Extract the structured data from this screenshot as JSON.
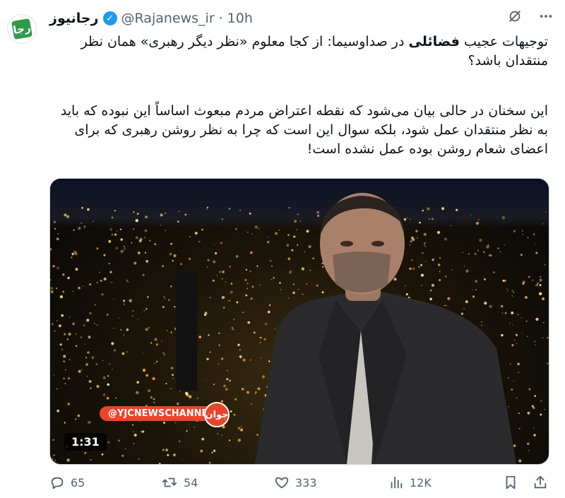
{
  "tweet": {
    "avatar_text": "رجا",
    "display_name": "رجانیوز",
    "verified_mark": "✓",
    "handle": "@Rajanews_ir",
    "separator": "·",
    "time": "10h",
    "headline_pre": "توجیهات عجیب ",
    "headline_bold": "فضائلی",
    "headline_post": " در صداوسیما: از کجا معلوم «نظر دیگر رهبری» همان نظر منتقدان باشد؟",
    "body": "این سخنان در حالی بیان می‌شود که نقطه اعتراض مردم مبعوث اساساً این نبوده که باید به نظر منتقدان عمل شود، بلکه سوال این است که چرا به نظر روشن رهبری که برای اعضای شعام روشن بوده عمل نشده است!"
  },
  "media": {
    "channel_tag": "@YJCNEWSCHANNEL",
    "channel_logo": "جوان",
    "duration": "1:31"
  },
  "actions": {
    "replies": "65",
    "reposts": "54",
    "likes": "333",
    "views": "12K"
  },
  "icons": {
    "more": "more-icon",
    "grok": "grok-icon",
    "reply": "reply-icon",
    "repost": "repost-icon",
    "like": "heart-icon",
    "views": "views-icon",
    "bookmark": "bookmark-icon",
    "share": "share-icon"
  },
  "colors": {
    "verified": "#1d9bf0",
    "muted": "#536471",
    "brand_green": "#2e9b49",
    "channel_red": "#e8452a"
  }
}
